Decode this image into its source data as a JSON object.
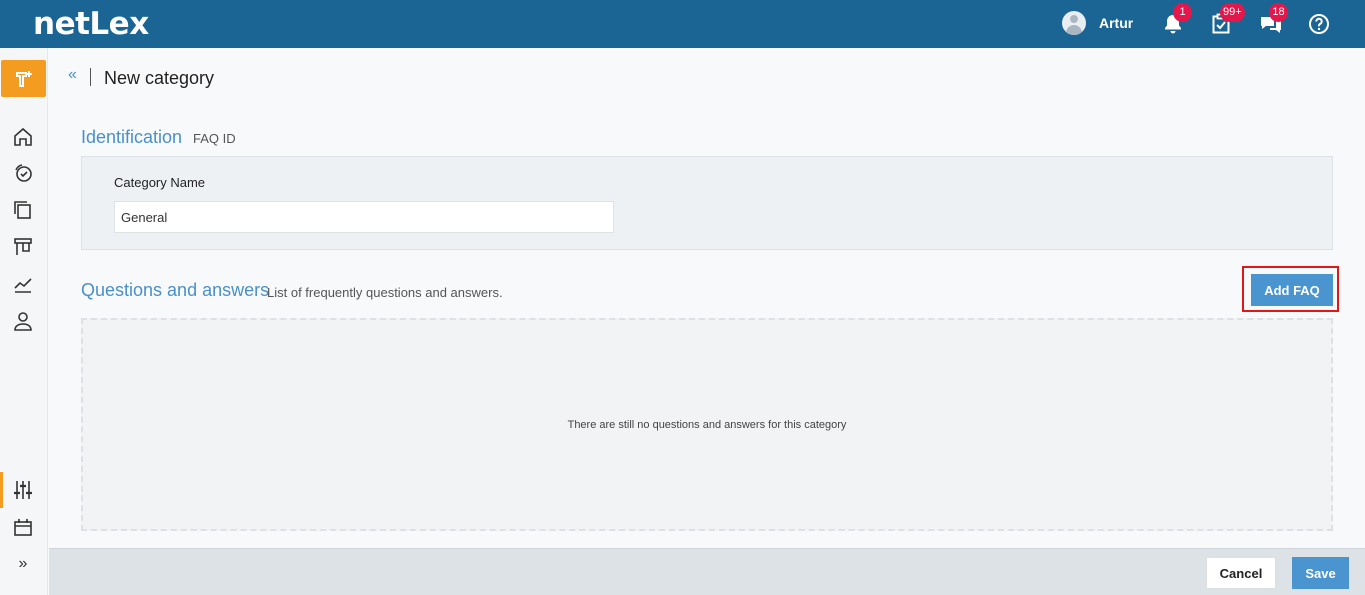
{
  "header": {
    "logo": "netLex",
    "user_name": "Artur",
    "badges": {
      "notifications": "1",
      "tasks": "99+",
      "messages": "18"
    },
    "icons": [
      "bell-icon",
      "task-check-icon",
      "chat-icon",
      "help-icon"
    ]
  },
  "sidebar": {
    "icons": [
      "add-document-icon",
      "home-icon",
      "tasks-icon",
      "documents-icon",
      "board-icon",
      "analytics-icon",
      "user-icon",
      "settings-sliders-icon",
      "calendar-icon",
      "expand-icon"
    ],
    "expand_label": "»"
  },
  "page": {
    "back_label": "«",
    "title": "New category"
  },
  "identification": {
    "title": "Identification",
    "subtitle": "FAQ ID",
    "category_name_label": "Category Name",
    "category_name_value": "General"
  },
  "qa": {
    "title": "Questions and answers",
    "subtitle": "List of frequently questions and answers.",
    "add_button": "Add FAQ",
    "empty_message": "There are still no questions and answers for this category"
  },
  "footer": {
    "cancel": "Cancel",
    "save": "Save"
  },
  "colors": {
    "topbar": "#1a6594",
    "accent": "#4a90c8",
    "sidebar_accent": "#f39c1f",
    "badge": "#e3174b",
    "highlight_frame": "#e01717"
  }
}
